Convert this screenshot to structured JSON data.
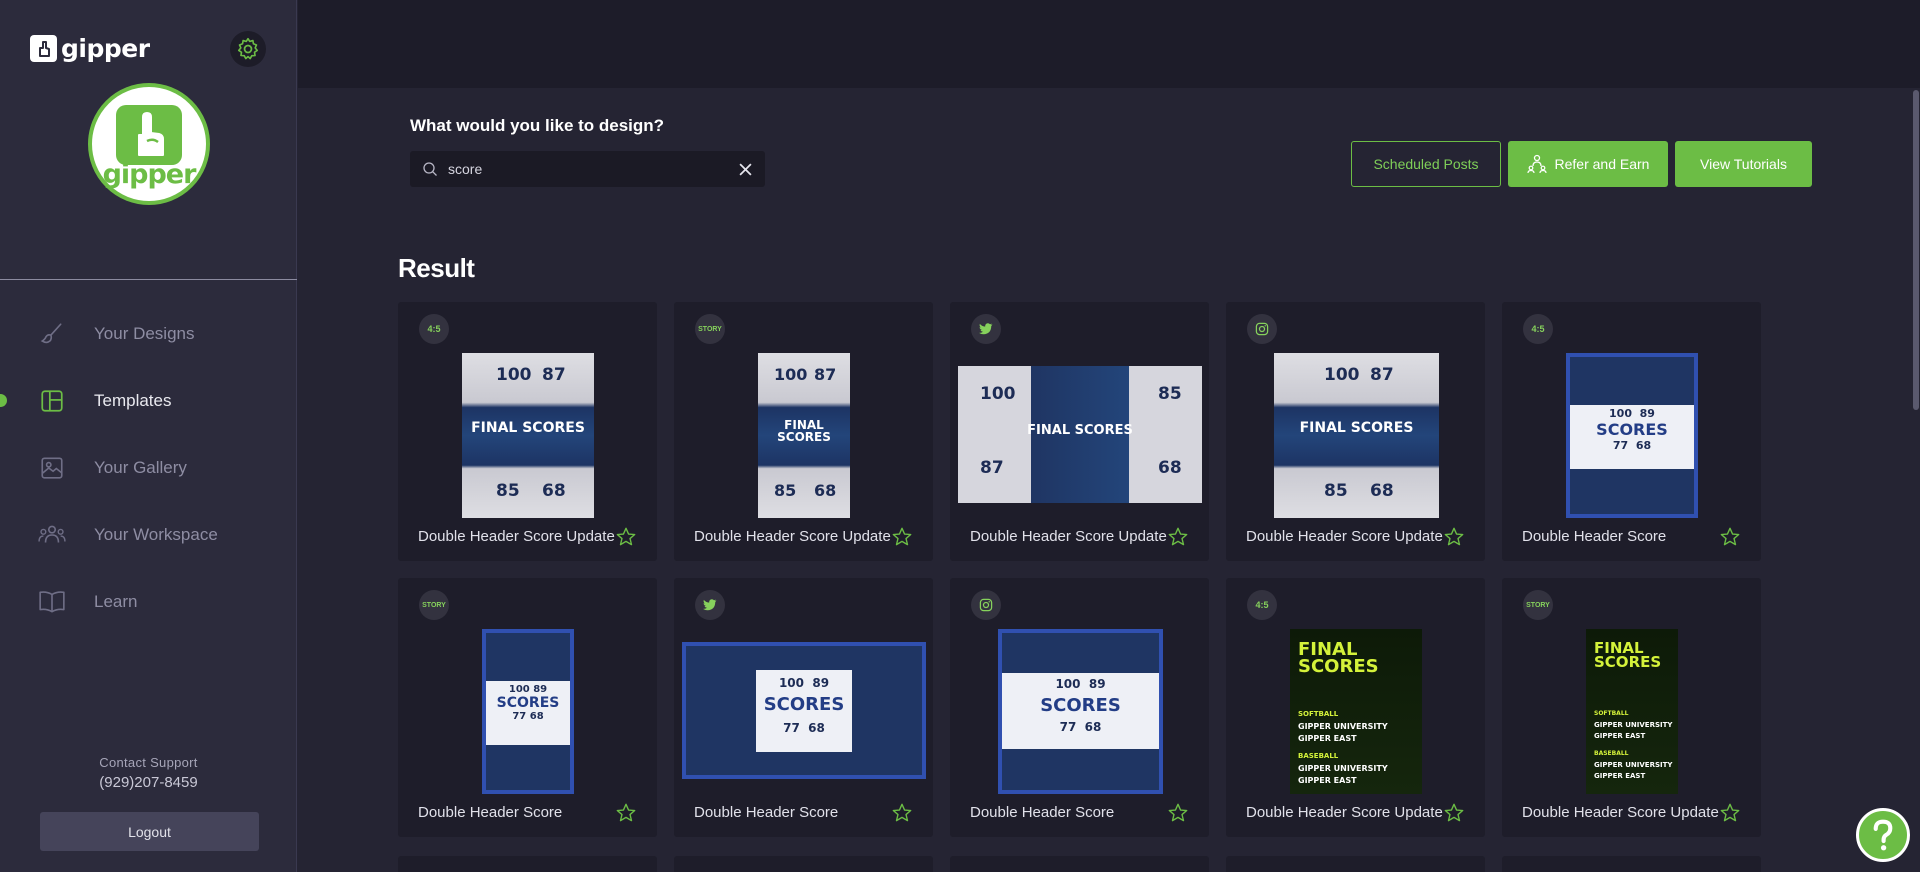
{
  "sidebar": {
    "brand": "gipper",
    "logo_word": "gipper",
    "nav": [
      {
        "label": "Your Designs",
        "icon": "brush-icon",
        "active": false
      },
      {
        "label": "Templates",
        "icon": "templates-icon",
        "active": true
      },
      {
        "label": "Your Gallery",
        "icon": "gallery-icon",
        "active": false
      },
      {
        "label": "Your Workspace",
        "icon": "workspace-icon",
        "active": false
      },
      {
        "label": "Learn",
        "icon": "book-icon",
        "active": false
      }
    ],
    "support_label": "Contact Support",
    "support_phone": "(929)207-8459",
    "logout_label": "Logout"
  },
  "main": {
    "prompt": "What would you like to design?",
    "search_value": "score",
    "buttons": {
      "scheduled": "Scheduled Posts",
      "refer": "Refer and Earn",
      "tutorials": "View Tutorials"
    },
    "result_title": "Result"
  },
  "cards": [
    {
      "badge": "4:5",
      "title": "Double Header Score Update",
      "thumb": "grey"
    },
    {
      "badge": "STORY",
      "title": "Double Header Score Update",
      "thumb": "grey"
    },
    {
      "badge": "twitter-icon",
      "title": "Double Header Score Update",
      "thumb": "wide"
    },
    {
      "badge": "instagram-icon",
      "title": "Double Header Score Update",
      "thumb": "grey"
    },
    {
      "badge": "4:5",
      "title": "Double Header Score",
      "thumb": "blue"
    },
    {
      "badge": "STORY",
      "title": "Double Header Score",
      "thumb": "blue"
    },
    {
      "badge": "twitter-icon",
      "title": "Double Header Score",
      "thumb": "blue"
    },
    {
      "badge": "instagram-icon",
      "title": "Double Header Score",
      "thumb": "blue"
    },
    {
      "badge": "4:5",
      "title": "Double Header Score Update",
      "thumb": "green"
    },
    {
      "badge": "STORY",
      "title": "Double Header Score Update",
      "thumb": "green"
    }
  ],
  "thumb_text": {
    "final_scores": "FINAL SCORES",
    "scores": "SCORES",
    "a": "100",
    "b": "87",
    "c": "85",
    "d": "68",
    "e": "89",
    "f": "77",
    "softball": "SOFTBALL",
    "baseball": "BASEBALL",
    "gipper_university": "GIPPER UNIVERSITY",
    "gipper_east": "GIPPER EAST"
  },
  "colors": {
    "accent": "#6cbd45",
    "sidebar_bg": "#2c2b3c",
    "main_bg": "#252433",
    "card_bg": "#1e1d2a"
  }
}
